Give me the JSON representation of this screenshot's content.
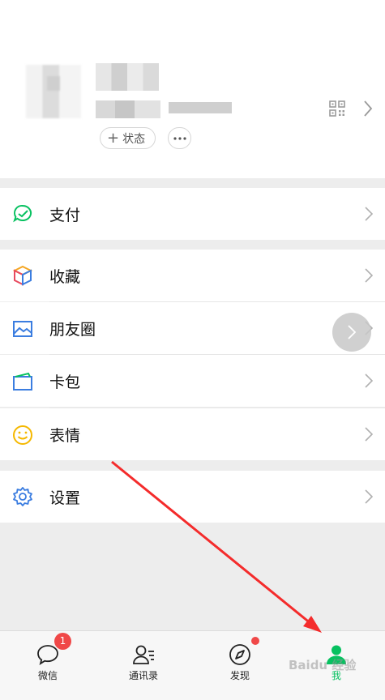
{
  "profile": {
    "status_label": "状态",
    "status_plus": "+",
    "more_label": "···"
  },
  "menu": {
    "pay": "支付",
    "favorites": "收藏",
    "moments": "朋友圈",
    "cards": "卡包",
    "stickers": "表情",
    "settings": "设置"
  },
  "tabs": [
    {
      "label": "微信",
      "badge": "1",
      "icon": "chat-bubble-icon"
    },
    {
      "label": "通讯录",
      "icon": "contacts-icon"
    },
    {
      "label": "发现",
      "icon": "compass-icon"
    },
    {
      "label": "我",
      "icon": "person-icon",
      "active": true
    }
  ],
  "watermark": "Baidu 经验",
  "colors": {
    "accent": "#07c160",
    "badge": "#f04848",
    "arrow": "#f42b2b"
  }
}
